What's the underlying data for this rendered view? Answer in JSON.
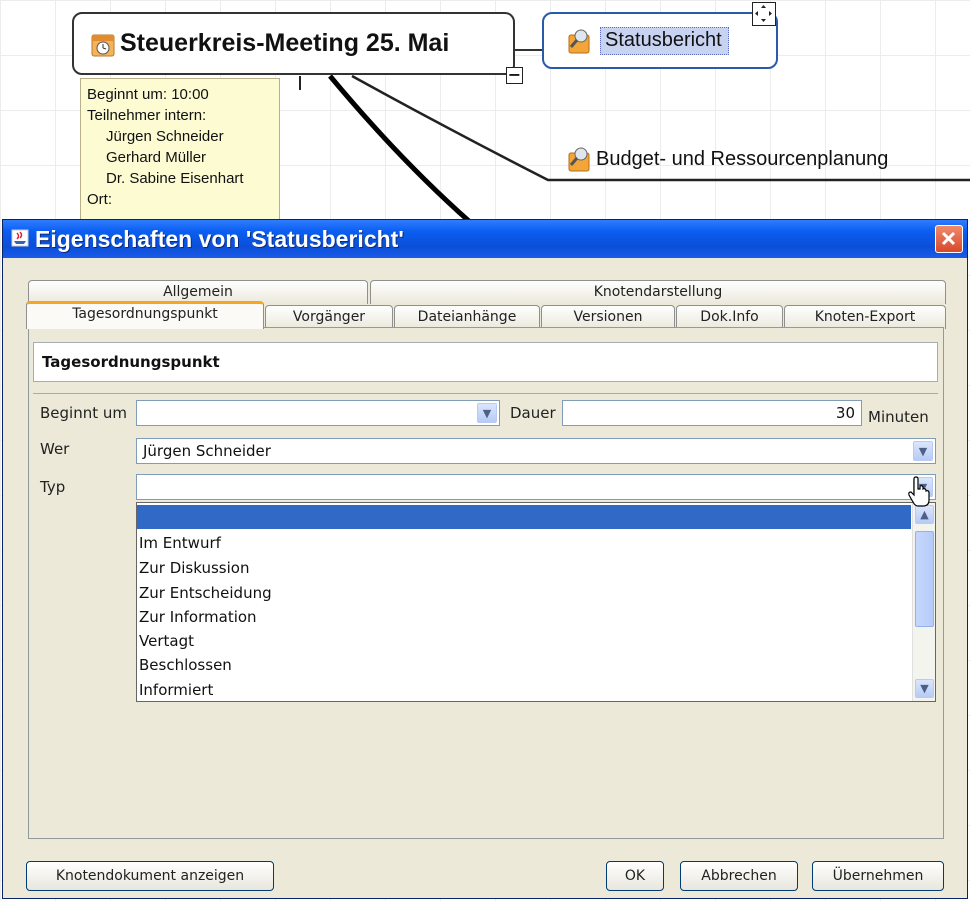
{
  "mindmap": {
    "main_node": "Steuerkreis-Meeting 25. Mai",
    "status_node": "Statusbericht",
    "budget_node": "Budget- und Ressourcenplanung",
    "collapse_symbol": "−",
    "note": {
      "line1": "Beginnt um: 10:00",
      "line2": "Teilnehmer intern:",
      "participants": [
        "Jürgen Schneider",
        "Gerhard Müller",
        "Dr. Sabine Eisenhart"
      ],
      "line6": "Ort:"
    }
  },
  "dialog": {
    "title": "Eigenschaften von 'Statusbericht'",
    "tabs_top": [
      "Allgemein",
      "Knotendarstellung"
    ],
    "tabs_bottom": [
      "Tagesordnungspunkt",
      "Vorgänger",
      "Dateianhänge",
      "Versionen",
      "Dok.Info",
      "Knoten-Export"
    ],
    "section_title": "Tagesordnungspunkt",
    "fields": {
      "beginnt_label": "Beginnt um",
      "beginnt_value": "",
      "dauer_label": "Dauer",
      "dauer_value": "30",
      "dauer_unit": "Minuten",
      "wer_label": "Wer",
      "wer_value": "Jürgen Schneider",
      "typ_label": "Typ",
      "typ_value": ""
    },
    "typ_options": [
      "",
      "Im Entwurf",
      "Zur Diskussion",
      "Zur Entscheidung",
      "Zur Information",
      "Vertagt",
      "Beschlossen",
      "Informiert"
    ],
    "buttons": {
      "show_doc": "Knotendokument anzeigen",
      "ok": "OK",
      "cancel": "Abbrechen",
      "apply": "Übernehmen"
    }
  },
  "colors": {
    "titlebar": "#0b4fd8",
    "selection": "#3169c6",
    "note_bg": "#fdfbd2",
    "dialog_bg": "#ece9d8"
  }
}
